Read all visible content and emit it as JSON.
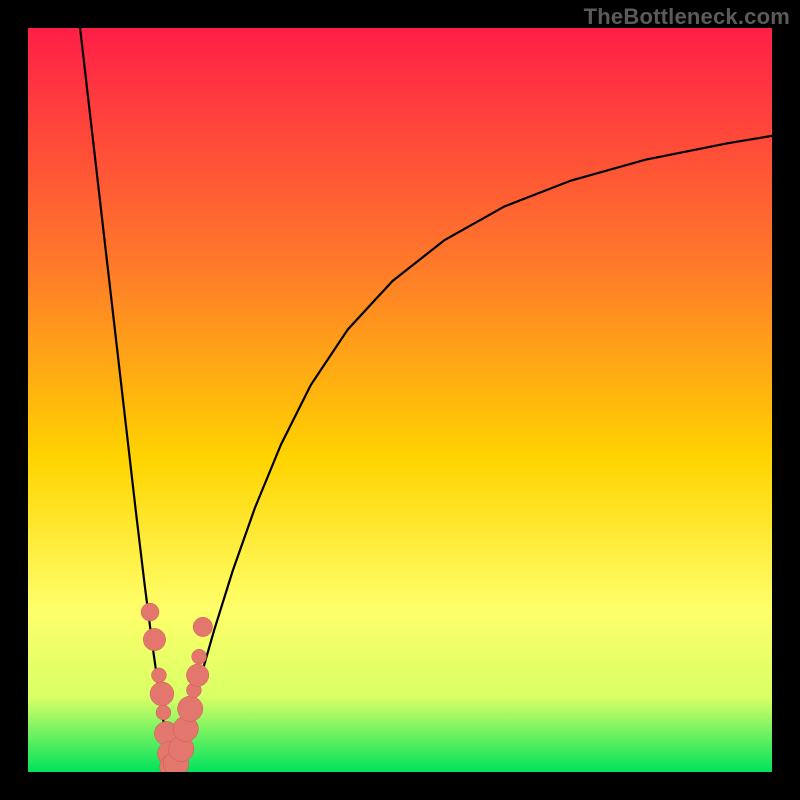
{
  "watermark": "TheBottleneck.com",
  "colors": {
    "gradient_top": "#ff1f47",
    "gradient_mid1": "#ff7a2a",
    "gradient_mid2": "#ffd400",
    "gradient_mid3": "#ffff6a",
    "gradient_mid4": "#d9ff66",
    "gradient_bottom": "#00e35c",
    "curve": "#000000",
    "marker_fill": "#e4776d",
    "marker_stroke": "#c85a52"
  },
  "chart_data": {
    "type": "line",
    "title": "",
    "xlabel": "",
    "ylabel": "",
    "xlim": [
      0,
      100
    ],
    "ylim": [
      0,
      100
    ],
    "series": [
      {
        "name": "left-branch",
        "x": [
          7,
          8.5,
          10,
          11.5,
          13,
          14.5,
          15.7,
          16.8,
          17.8,
          18.4,
          18.9,
          19.2,
          19.4
        ],
        "y": [
          100,
          87,
          74,
          61,
          48,
          35,
          25,
          16.5,
          9.5,
          5.5,
          2.7,
          1.2,
          0.4
        ]
      },
      {
        "name": "right-branch",
        "x": [
          19.4,
          19.9,
          20.6,
          21.6,
          23,
          25,
          27.5,
          30.5,
          34,
          38,
          43,
          49,
          56,
          64,
          73,
          83,
          94,
          100
        ],
        "y": [
          0.4,
          1.5,
          3.6,
          7,
          12,
          19,
          27,
          35.5,
          44,
          52,
          59.5,
          66,
          71.5,
          76,
          79.5,
          82.3,
          84.5,
          85.5
        ]
      }
    ],
    "markers": [
      {
        "x": 16.4,
        "y": 21.5,
        "r": 1.2
      },
      {
        "x": 17.0,
        "y": 17.8,
        "r": 1.5
      },
      {
        "x": 17.6,
        "y": 13,
        "r": 1.0
      },
      {
        "x": 18.0,
        "y": 10.5,
        "r": 1.6
      },
      {
        "x": 18.2,
        "y": 8,
        "r": 1.0
      },
      {
        "x": 18.6,
        "y": 5.2,
        "r": 1.6
      },
      {
        "x": 19.0,
        "y": 2.5,
        "r": 1.6
      },
      {
        "x": 19.4,
        "y": 0.7,
        "r": 1.7
      },
      {
        "x": 19.9,
        "y": 1.1,
        "r": 1.7
      },
      {
        "x": 20.6,
        "y": 3.1,
        "r": 1.7
      },
      {
        "x": 21.2,
        "y": 5.8,
        "r": 1.7
      },
      {
        "x": 21.8,
        "y": 8.5,
        "r": 1.7
      },
      {
        "x": 22.3,
        "y": 11,
        "r": 1.0
      },
      {
        "x": 22.8,
        "y": 13,
        "r": 1.5
      },
      {
        "x": 23.0,
        "y": 15.5,
        "r": 1.0
      },
      {
        "x": 23.5,
        "y": 19.5,
        "r": 1.3
      }
    ]
  }
}
